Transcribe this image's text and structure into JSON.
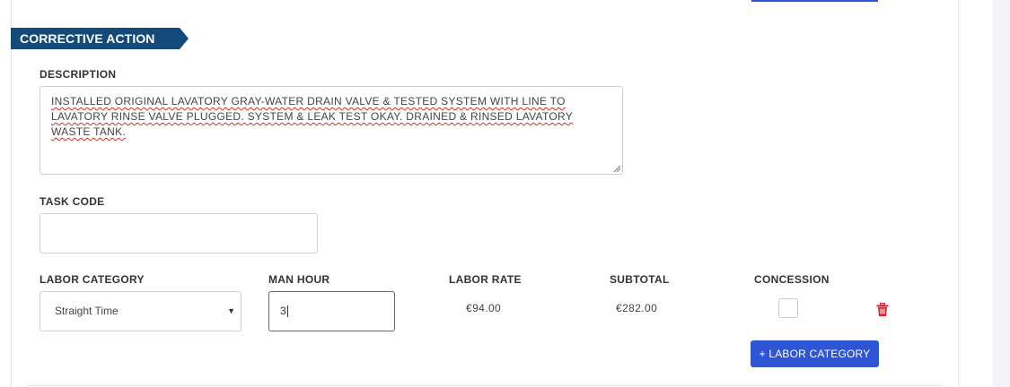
{
  "section": {
    "title": "CORRECTIVE ACTION",
    "color": "#144a7a"
  },
  "description": {
    "label": "DESCRIPTION",
    "value": "INSTALLED ORIGINAL LAVATORY GRAY-WATER DRAIN VALVE & TESTED SYSTEM WITH LINE TO LAVATORY RINSE VALVE PLUGGED. SYSTEM & LEAK TEST OKAY. DRAINED & RINSED LAVATORY WASTE TANK."
  },
  "task_code": {
    "label": "TASK CODE",
    "value": ""
  },
  "labor": {
    "headers": {
      "category": "LABOR CATEGORY",
      "man_hour": "MAN HOUR",
      "rate": "LABOR RATE",
      "subtotal": "SUBTOTAL",
      "concession": "CONCESSION"
    },
    "rows": [
      {
        "category": "Straight Time",
        "man_hour": "3",
        "rate": "€94.00",
        "subtotal": "€282.00",
        "concession": false
      }
    ],
    "add_button": "+ LABOR CATEGORY"
  },
  "colors": {
    "accent": "#2f55d4",
    "delete": "#d9232d",
    "focus": "#2f6fd6"
  },
  "icons": {
    "delete": "trash-icon",
    "dropdown": "chevron-down-icon"
  }
}
